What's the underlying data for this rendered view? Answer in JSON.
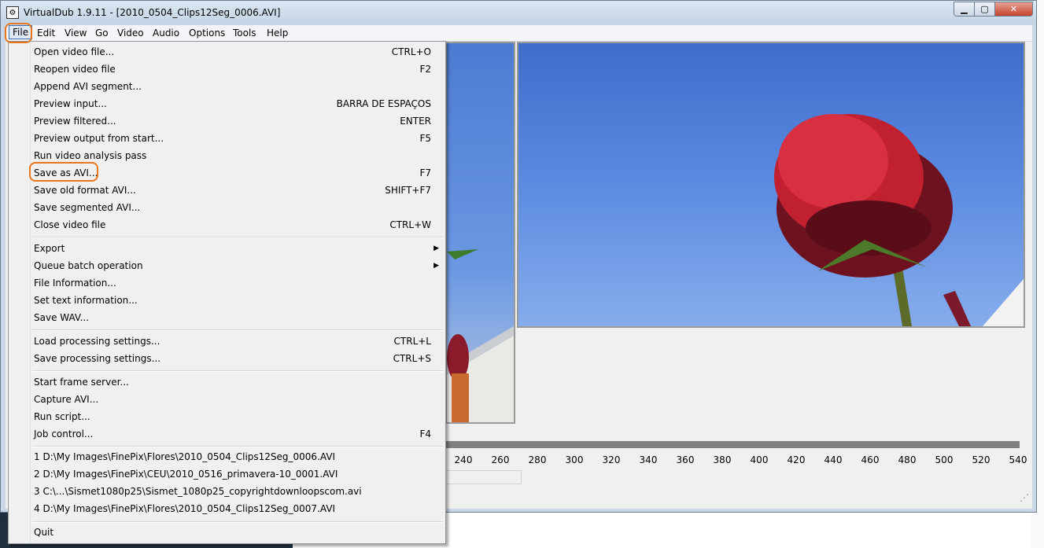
{
  "window": {
    "title": "VirtualDub 1.9.11 - [2010_0504_Clips12Seg_0006.AVI]",
    "min_glyph": "▁",
    "max_glyph": "▢",
    "close_glyph": "✕"
  },
  "menubar": [
    "File",
    "Edit",
    "View",
    "Go",
    "Video",
    "Audio",
    "Options",
    "Tools",
    "Help"
  ],
  "file_menu": {
    "items": [
      {
        "label": "Open video file...",
        "shortcut": "CTRL+O"
      },
      {
        "label": "Reopen video file",
        "shortcut": "F2"
      },
      {
        "label": "Append AVI segment...",
        "shortcut": ""
      },
      {
        "label": "Preview input...",
        "shortcut": "BARRA DE ESPAÇOS"
      },
      {
        "label": "Preview filtered...",
        "shortcut": "ENTER"
      },
      {
        "label": "Preview output from start...",
        "shortcut": "F5"
      },
      {
        "label": "Run video analysis pass",
        "shortcut": ""
      },
      {
        "label": "Save as AVI...",
        "shortcut": "F7"
      },
      {
        "label": "Save old format AVI...",
        "shortcut": "SHIFT+F7"
      },
      {
        "label": "Save segmented AVI...",
        "shortcut": ""
      },
      {
        "label": "Close video file",
        "shortcut": "CTRL+W"
      },
      {
        "label": "Export",
        "shortcut": "",
        "submenu": true
      },
      {
        "label": "Queue batch operation",
        "shortcut": "",
        "submenu": true
      },
      {
        "label": "File Information...",
        "shortcut": ""
      },
      {
        "label": "Set text information...",
        "shortcut": ""
      },
      {
        "label": "Save WAV...",
        "shortcut": ""
      },
      {
        "label": "Load processing settings...",
        "shortcut": "CTRL+L"
      },
      {
        "label": "Save processing settings...",
        "shortcut": "CTRL+S"
      },
      {
        "label": "Start frame server...",
        "shortcut": ""
      },
      {
        "label": "Capture AVI...",
        "shortcut": ""
      },
      {
        "label": "Run script...",
        "shortcut": ""
      },
      {
        "label": "Job control...",
        "shortcut": "F4"
      },
      {
        "label": "1 D:\\My Images\\FinePix\\Flores\\2010_0504_Clips12Seg_0006.AVI",
        "shortcut": ""
      },
      {
        "label": "2 D:\\My Images\\FinePix\\CEU\\2010_0516_primavera-10_0001.AVI",
        "shortcut": ""
      },
      {
        "label": "3 C:\\...\\Sismet1080p25\\Sismet_1080p25_copyrightdownloopscom.avi",
        "shortcut": ""
      },
      {
        "label": "4 D:\\My Images\\FinePix\\Flores\\2010_0504_Clips12Seg_0007.AVI",
        "shortcut": ""
      },
      {
        "label": "Quit",
        "shortcut": ""
      }
    ],
    "submenu_glyph": "▶"
  },
  "timeline": {
    "ticks": [
      "240",
      "260",
      "280",
      "300",
      "320",
      "340",
      "360",
      "380",
      "400",
      "420",
      "440",
      "460",
      "480",
      "500",
      "520",
      "540"
    ]
  },
  "colors": {
    "highlight": "#e8761f",
    "menu_bg": "#f0f0f0"
  }
}
